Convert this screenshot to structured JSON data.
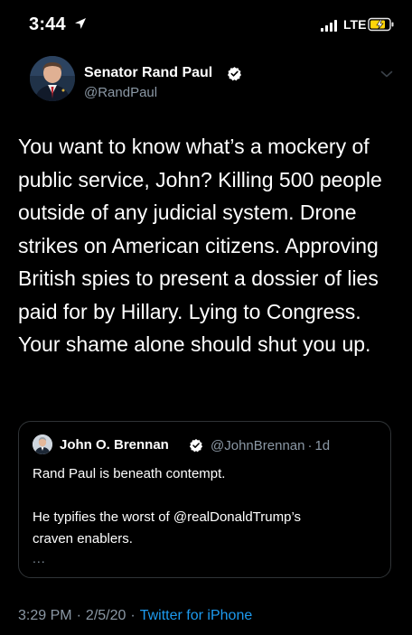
{
  "status_bar": {
    "time": "3:44",
    "network": "LTE",
    "battery_color": "#ffd60a",
    "icons": [
      "location-arrow-icon",
      "signal-bars-icon",
      "battery-charging-icon"
    ]
  },
  "tweet": {
    "author": {
      "name": "Senator Rand Paul",
      "handle": "@RandPaul",
      "verified": true
    },
    "text": "You want to know what’s a mockery of public service, John? Killing 500 people outside of any judicial system. Drone strikes on American citizens. Approving British spies to present a dossier of lies paid for by Hillary. Lying to Congress. Your shame alone should shut you up.",
    "quoted": {
      "name": "John O. Brennan",
      "handle": "@JohnBrennan",
      "age": "1d",
      "separator": "·",
      "lines": [
        "Rand Paul is beneath contempt.",
        "He typifies the worst of @realDonaldTrump’s",
        "craven enablers."
      ],
      "ellipsis": "..."
    },
    "meta": {
      "time": "3:29 PM",
      "date": "2/5/20",
      "separator": "·",
      "source": "Twitter for iPhone"
    }
  },
  "colors": {
    "background": "#000000",
    "text": "#ffffff",
    "secondary": "#8b98a5",
    "link": "#1d9bf0",
    "verified": "#ffffff",
    "card_border": "#2f3336"
  }
}
